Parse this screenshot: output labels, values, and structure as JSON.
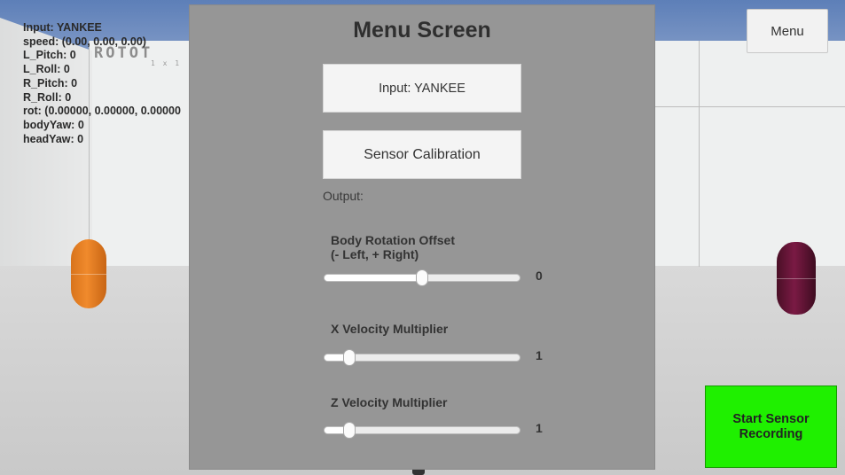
{
  "scene": {
    "sign_text": "ROTOT",
    "sign_sub": "1 x 1"
  },
  "debug": {
    "lines": [
      "Input: YANKEE",
      "speed: (0.00, 0.00, 0.00)",
      "L_Pitch: 0",
      "L_Roll: 0",
      "R_Pitch: 0",
      "R_Roll: 0",
      "rot: (0.00000, 0.00000, 0.00000",
      "bodyYaw: 0",
      "headYaw: 0"
    ]
  },
  "menu_button": {
    "label": "Menu"
  },
  "record_button": {
    "line1": "Start Sensor",
    "line2": "Recording",
    "color": "#1ff000"
  },
  "panel": {
    "title": "Menu Screen",
    "input_button": "Input: YANKEE",
    "calibration_button": "Sensor Calibration",
    "output_label": "Output:",
    "sliders": [
      {
        "label_line1": "Body Rotation Offset",
        "label_line2": "(- Left, + Right)",
        "value": "0",
        "fraction": 0.5
      },
      {
        "label_line1": "X Velocity Multiplier",
        "label_line2": "",
        "value": "1",
        "fraction": 0.1
      },
      {
        "label_line1": "Z Velocity Multiplier",
        "label_line2": "",
        "value": "1",
        "fraction": 0.1
      }
    ]
  }
}
